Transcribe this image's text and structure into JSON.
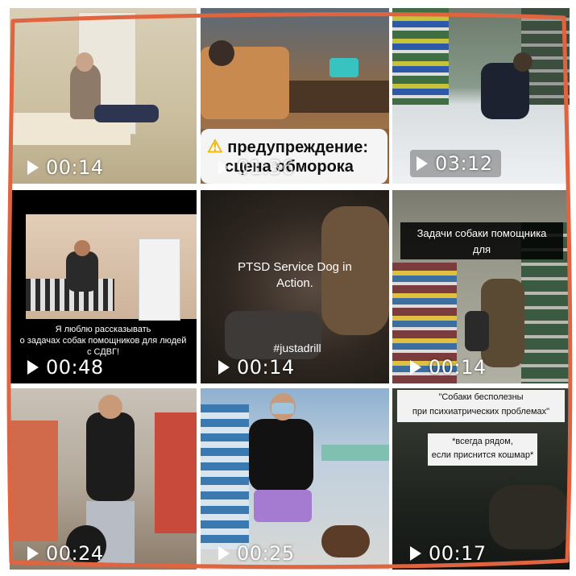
{
  "tiles": [
    {
      "duration": "00:14",
      "top_caption": "",
      "bottom_caption": "",
      "overlay_caption": ""
    },
    {
      "duration": "01:36",
      "warning_line1": "предупреждение:",
      "warning_line2": "сцена обморока"
    },
    {
      "duration": "03:12"
    },
    {
      "duration": "00:48",
      "caption": "Я люблю рассказывать\nо задачах собак помощников для людей\nс СДВГ!"
    },
    {
      "duration": "00:14",
      "title": "PTSD Service Dog in\nAction.",
      "hashtag": "#justadrill"
    },
    {
      "duration": "00:14",
      "caption": "Задачи собаки помощника\nдля"
    },
    {
      "duration": "00:24"
    },
    {
      "duration": "00:25"
    },
    {
      "duration": "00:17",
      "quote1": "\"Собаки бесполезны\nпри психиатрических проблемах\"",
      "quote2": "*всегда рядом,\nесли приснится кошмар*"
    }
  ],
  "colors": {
    "frame": "#e0643f",
    "background": "#ffffff",
    "caption_dark": "#111111"
  },
  "icons": {
    "play": "play-icon",
    "warning": "warning-icon"
  }
}
